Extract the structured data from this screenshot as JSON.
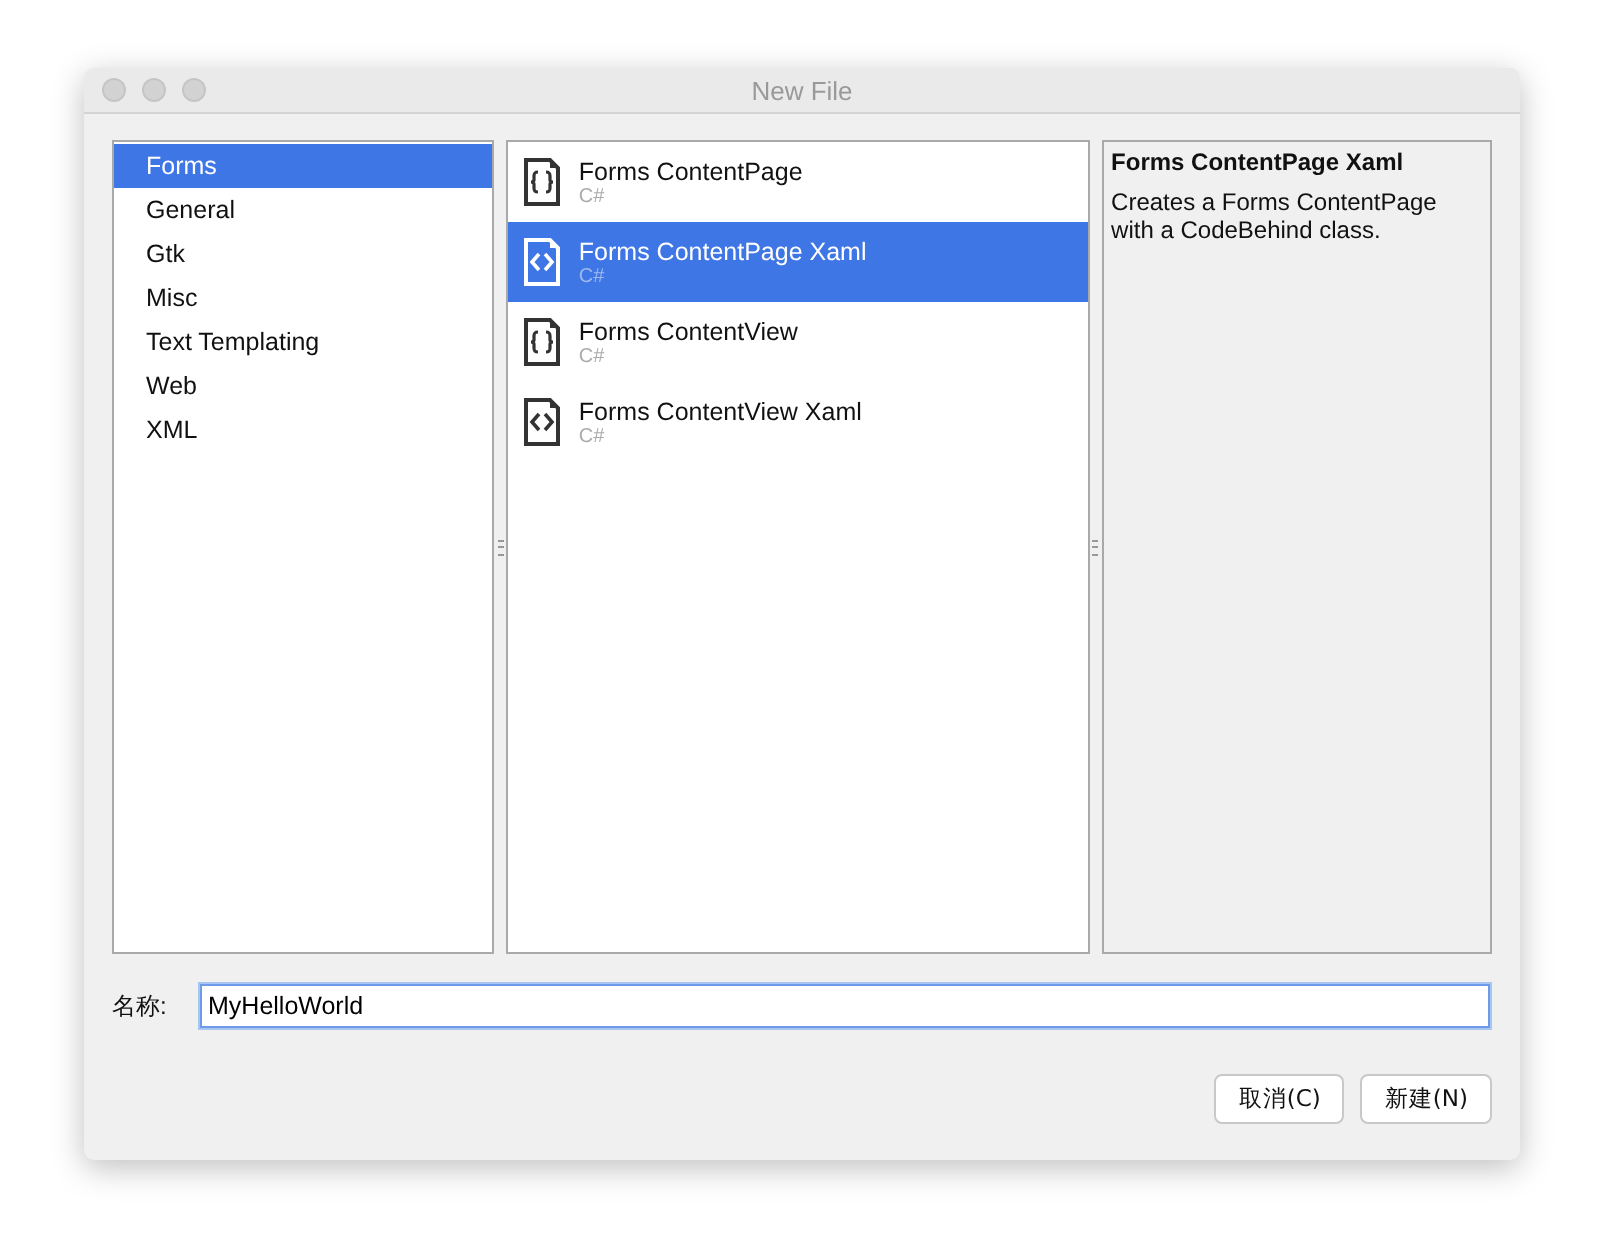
{
  "window": {
    "title": "New File"
  },
  "categories": [
    {
      "label": "Forms",
      "selected": true
    },
    {
      "label": "General",
      "selected": false
    },
    {
      "label": "Gtk",
      "selected": false
    },
    {
      "label": "Misc",
      "selected": false
    },
    {
      "label": "Text Templating",
      "selected": false
    },
    {
      "label": "Web",
      "selected": false
    },
    {
      "label": "XML",
      "selected": false
    }
  ],
  "templates": [
    {
      "name": "Forms ContentPage",
      "language": "C#",
      "kind": "braces",
      "selected": false
    },
    {
      "name": "Forms ContentPage Xaml",
      "language": "C#",
      "kind": "angle",
      "selected": true
    },
    {
      "name": "Forms ContentView",
      "language": "C#",
      "kind": "braces",
      "selected": false
    },
    {
      "name": "Forms ContentView Xaml",
      "language": "C#",
      "kind": "angle",
      "selected": false
    }
  ],
  "description": {
    "title": "Forms ContentPage Xaml",
    "text": "Creates a Forms ContentPage with a CodeBehind class."
  },
  "name_field": {
    "label": "名称:",
    "value": "MyHelloWorld"
  },
  "buttons": [
    "取消(C)",
    "新建(N)"
  ]
}
